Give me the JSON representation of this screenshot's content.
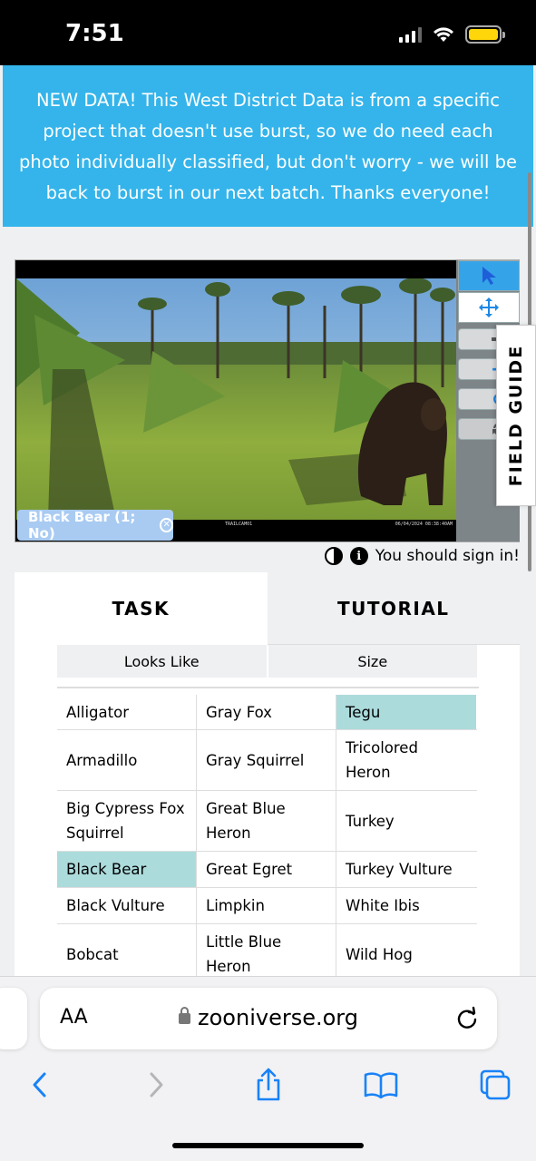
{
  "status_bar": {
    "time": "7:51"
  },
  "banner": {
    "text": "NEW DATA! This West District Data is from a specific project that doesn't use burst, so we do need each photo individually classified, but don't worry - we will be back to burst in our next batch. Thanks everyone!"
  },
  "viewer": {
    "mark_label": "Black Bear (1; No)",
    "camera_name": "TRAILCAM01",
    "timestamp": "06/04/2024  08:38:40AM",
    "tools": [
      "pointer-icon",
      "move-icon",
      "zoom-out-icon",
      "zoom-in-icon",
      "rotate-icon",
      "reset-icon"
    ]
  },
  "field_guide": {
    "label": "FIELD GUIDE"
  },
  "signin": {
    "text": "You should sign in!"
  },
  "task_panel": {
    "tabs": [
      {
        "label": "TASK",
        "active": true
      },
      {
        "label": "TUTORIAL",
        "active": false
      }
    ],
    "filters": [
      "Looks Like",
      "Size"
    ],
    "choices": [
      [
        "Alligator",
        "Gray Fox",
        "Tegu"
      ],
      [
        "Armadillo",
        "Gray Squirrel",
        "Tricolored Heron"
      ],
      [
        "Big Cypress Fox Squirrel",
        "Great Blue Heron",
        "Turkey"
      ],
      [
        "Black Bear",
        "Great Egret",
        "Turkey Vulture"
      ],
      [
        "Black Vulture",
        "Limpkin",
        "White Ibis"
      ],
      [
        "Bobcat",
        "Little Blue Heron",
        "Wild Hog"
      ]
    ],
    "selected": [
      "Tegu",
      "Black Bear"
    ],
    "selected_color": "#acdbdc"
  },
  "browser": {
    "text_size_label": "AA",
    "url": "zooniverse.org"
  },
  "colors": {
    "banner": "#34b4ea",
    "accent": "#1e88e5"
  }
}
